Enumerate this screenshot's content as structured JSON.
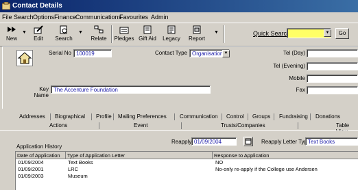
{
  "window": {
    "title": "Contact Details"
  },
  "menu": [
    "File",
    "Search",
    "Options",
    "Finance",
    "Communications",
    "Favourites",
    "Admin"
  ],
  "toolbar": {
    "new": "New",
    "edit": "Edit",
    "search": "Search",
    "relate": "Relate",
    "pledges": "Pledges",
    "gift_aid": "Gift Aid",
    "legacy": "Legacy",
    "report": "Report",
    "quick_search_label": "Quick Search",
    "quick_search_value": "",
    "go": "Go"
  },
  "contact": {
    "serial_label": "Serial No",
    "serial_value": "100019",
    "contact_type_label": "Contact Type",
    "contact_type_value": "Organisation",
    "key_name_label": "Key Name",
    "key_name_value": "The Accenture Foundation",
    "tel_day_label": "Tel (Day)",
    "tel_evening_label": "Tel (Evening)",
    "mobile_label": "Mobile",
    "fax_label": "Fax"
  },
  "tabs_row1": [
    "Addresses",
    "Biographical",
    "Profile",
    "Mailing Preferences",
    "Communication",
    "Control",
    "Groups",
    "Fundraising",
    "Donations"
  ],
  "tabs_row2": [
    "Actions",
    "Event",
    "Trusts/Companies",
    "Table View"
  ],
  "app_history": {
    "label": "Application History",
    "reapply_label": "Reapply",
    "reapply_value": "01/09/2004",
    "letter_type_label": "Reapply Letter Type",
    "letter_type_value": "Text Books",
    "columns": [
      "Date of Application",
      "Type of Application Letter",
      "Response to Application"
    ],
    "rows": [
      [
        "01/09/2004",
        "Text Books",
        "NO"
      ],
      [
        "01/09/2001",
        "LRC",
        "No-only re-apply if the College use Andersen"
      ],
      [
        "01/09/2003",
        "Museum",
        ""
      ]
    ]
  }
}
